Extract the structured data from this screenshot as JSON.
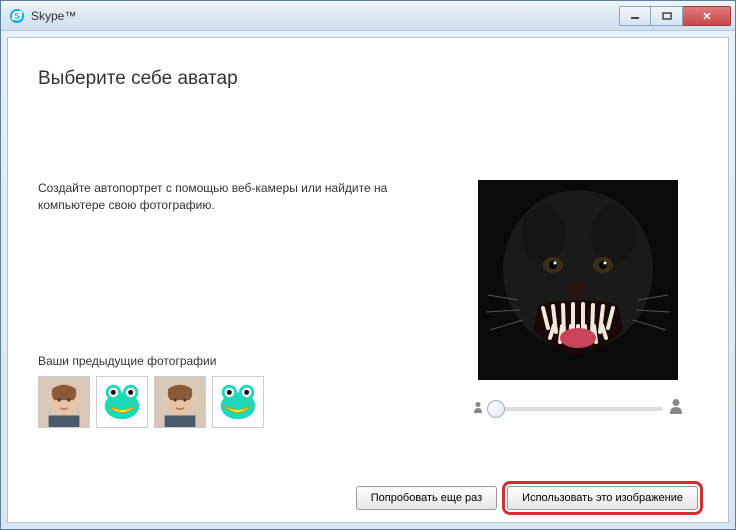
{
  "window": {
    "title": "Skype™"
  },
  "heading": "Выберите себе аватар",
  "instruction": "Создайте автопортрет с помощью веб-камеры или найдите на компьютере свою фотографию.",
  "previous": {
    "label": "Ваши предыдущие фотографии"
  },
  "slider": {
    "value": 0,
    "min": 0,
    "max": 100
  },
  "buttons": {
    "retry": "Попробовать еще раз",
    "use": "Использовать это изображение"
  }
}
